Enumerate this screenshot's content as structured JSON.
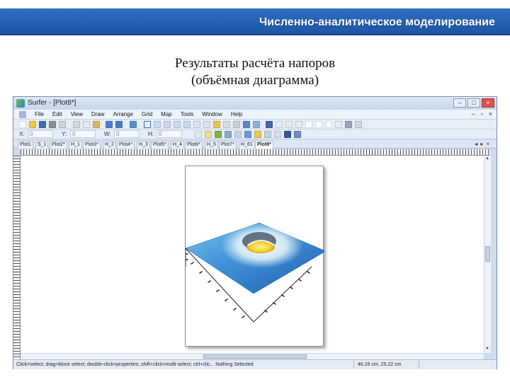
{
  "slide": {
    "banner_text": "Численно-аналитическое моделирование",
    "title_line1": "Результаты расчёта напоров",
    "title_line2": "(объёмная диаграмма)"
  },
  "window": {
    "title": "Surfer - [Plot8*]",
    "menu": [
      "File",
      "Edit",
      "View",
      "Draw",
      "Arrange",
      "Grid",
      "Map",
      "Tools",
      "Window",
      "Help"
    ],
    "coords": {
      "x_label": "X:",
      "x_value": "0",
      "y_label": "Y:",
      "y_value": "0",
      "w_label": "W:",
      "w_value": "0",
      "h_label": "H:",
      "h_value": "0"
    },
    "tabs": [
      "Plot1",
      "S_1",
      "Plot2*",
      "H_1",
      "Plot3*",
      "H_2",
      "Plot4*",
      "H_3",
      "Plot5*",
      "H_4",
      "Plot6*",
      "H_5",
      "Plot7*",
      "H_61",
      "Plot8*"
    ],
    "active_tab": "Plot8*",
    "status": {
      "hint": "Click=select; drag=block select; double-click=properties; shift+click=multi-select; ctrl+clic... Nothing Selected",
      "coords": "46.26 cm, 25.22 cm"
    }
  },
  "colors": {
    "banner": "#1d55a5",
    "surface_high": "#3f8fd6",
    "surface_low": "#e8f6fb",
    "peak": "#f2d22e"
  },
  "icons": [
    "new-icon",
    "open-icon",
    "save-icon",
    "print-icon",
    "cut-icon",
    "copy-icon",
    "paste-icon",
    "undo-icon",
    "redo-icon",
    "help-icon",
    "select-arrow-icon",
    "zoom-icon",
    "text-icon",
    "polygon-icon",
    "polyline-icon",
    "rectangle-icon",
    "ellipse-icon",
    "curve-icon"
  ]
}
